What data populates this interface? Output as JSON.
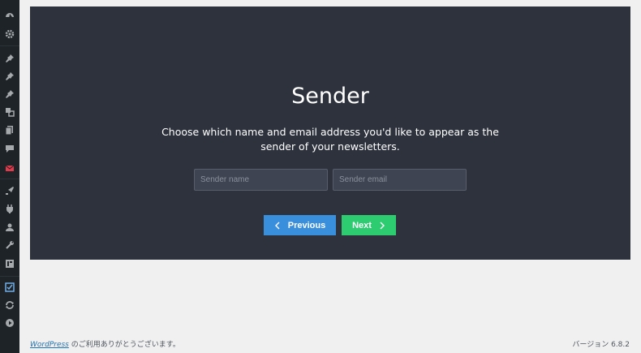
{
  "sidebar": {
    "icons": [
      "dashboard-icon",
      "settings-icon",
      "pin-icon",
      "pin-icon",
      "pin-icon",
      "media-icon",
      "pages-icon",
      "comments-icon",
      "mail-icon",
      "appearance-icon",
      "plugins-icon",
      "users-icon",
      "tools-icon",
      "settings-panel-icon",
      "checklist-icon",
      "sync-icon",
      "play-icon"
    ],
    "colors": {
      "background": "#1d2327",
      "icon": "#a7aaad",
      "mail_icon": "#e23a4b",
      "active_icon": "#72aee6"
    }
  },
  "wizard": {
    "title": "Sender",
    "description": "Choose which name and email address you'd like to appear as the sender of your newsletters.",
    "sender_name_placeholder": "Sender name",
    "sender_email_placeholder": "Sender email",
    "previous_label": "Previous",
    "next_label": "Next",
    "colors": {
      "panel": "#2d323d",
      "previous": "#3a8fdc",
      "next": "#2ecc71"
    }
  },
  "footer": {
    "link_text": "WordPress",
    "thanks_text": " のご利用ありがとうございます。",
    "version_text": "バージョン 6.8.2"
  }
}
